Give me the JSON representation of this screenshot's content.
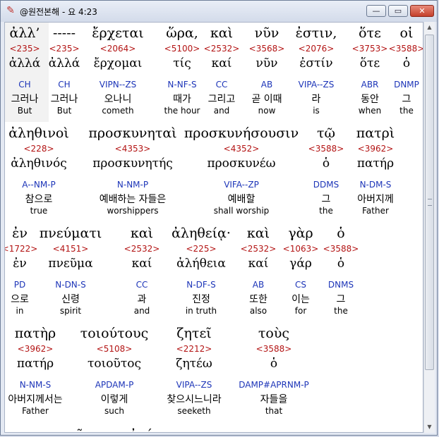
{
  "window": {
    "title": "@원전본해 - 요 4:23",
    "min_label": "—",
    "max_label": "▭",
    "close_label": "✕",
    "app_icon": "pen-icon"
  },
  "verse_rows": [
    {
      "words": [
        {
          "greek": "ἀλλ’",
          "strong": "<235>",
          "lemma": "ἀλλά",
          "parse": "CH",
          "korean": "그러나",
          "english": "But"
        },
        {
          "greek": "-----",
          "strong": "<235>",
          "lemma": "ἀλλά",
          "parse": "CH",
          "korean": "그러나",
          "english": "But"
        },
        {
          "greek": "ἔρχεται",
          "strong": "<2064>",
          "lemma": "ἔρχομαι",
          "parse": "VIPN--ZS",
          "korean": "오나니",
          "english": "cometh"
        },
        {
          "greek": "ὥρα,",
          "strong": "<5100>",
          "lemma": "τίς",
          "parse": "N-NF-S",
          "korean": "때가",
          "english": "the hour"
        },
        {
          "greek": "καὶ",
          "strong": "<2532>",
          "lemma": "καί",
          "parse": "CC",
          "korean": "그리고",
          "english": "and"
        },
        {
          "greek": "νῦν",
          "strong": "<3568>",
          "lemma": "νῦν",
          "parse": "AB",
          "korean": "곧 이때",
          "english": "now"
        },
        {
          "greek": "ἐστιν,",
          "strong": "<2076>",
          "lemma": "ἐστίν",
          "parse": "VIPA--ZS",
          "korean": "라",
          "english": "is"
        },
        {
          "greek": "ὅτε",
          "strong": "<3753>",
          "lemma": "ὅτε",
          "parse": "ABR",
          "korean": "동안",
          "english": "when"
        },
        {
          "greek": "οἱ",
          "strong": "<3588>",
          "lemma": "ὁ",
          "parse": "DNMP",
          "korean": "그",
          "english": "the"
        }
      ]
    },
    {
      "words": [
        {
          "greek": "ἀληθινοὶ",
          "strong": "<228>",
          "lemma": "ἀληθινός",
          "parse": "A--NM-P",
          "korean": "참으로",
          "english": "true"
        },
        {
          "greek": "προσκυνηταὶ",
          "strong": "<4353>",
          "lemma": "προσκυνητής",
          "parse": "N-NM-P",
          "korean": "예배하는 자들은",
          "english": "worshippers"
        },
        {
          "greek": "προσκυνήσουσιν",
          "strong": "<4352>",
          "lemma": "προσκυνέω",
          "parse": "VIFA--ZP",
          "korean": "예배할",
          "english": "shall worship"
        },
        {
          "greek": "τῷ",
          "strong": "<3588>",
          "lemma": "ὁ",
          "parse": "DDMS",
          "korean": "그",
          "english": "the"
        },
        {
          "greek": "πατρὶ",
          "strong": "<3962>",
          "lemma": "πατήρ",
          "parse": "N-DM-S",
          "korean": "아버지께",
          "english": "Father"
        }
      ]
    },
    {
      "words": [
        {
          "greek": "ἐν",
          "strong": "<1722>",
          "lemma": "ἐν",
          "parse": "PD",
          "korean": "으로",
          "english": "in"
        },
        {
          "greek": "πνεύματι",
          "strong": "<4151>",
          "lemma": "πνεῦμα",
          "parse": "N-DN-S",
          "korean": "신령",
          "english": "spirit"
        },
        {
          "greek": "καὶ",
          "strong": "<2532>",
          "lemma": "καί",
          "parse": "CC",
          "korean": "과",
          "english": "and"
        },
        {
          "greek": "ἀληθείᾳ·",
          "strong": "<225>",
          "lemma": "ἀλήθεια",
          "parse": "N-DF-S",
          "korean": "진정",
          "english": "in truth"
        },
        {
          "greek": "καὶ",
          "strong": "<2532>",
          "lemma": "καί",
          "parse": "AB",
          "korean": "또한",
          "english": "also"
        },
        {
          "greek": "γὰρ",
          "strong": "<1063>",
          "lemma": "γάρ",
          "parse": "CS",
          "korean": "이는",
          "english": "for"
        },
        {
          "greek": "ὁ",
          "strong": "<3588>",
          "lemma": "ὁ",
          "parse": "DNMS",
          "korean": "그",
          "english": "the"
        }
      ]
    },
    {
      "words": [
        {
          "greek": "πατὴρ",
          "strong": "<3962>",
          "lemma": "πατήρ",
          "parse": "N-NM-S",
          "korean": "아버지께서는",
          "english": "Father"
        },
        {
          "greek": "τοιούτους",
          "strong": "<5108>",
          "lemma": "τοιοῦτος",
          "parse": "APDAM-P",
          "korean": "이렇게",
          "english": "such"
        },
        {
          "greek": "ζητεῖ",
          "strong": "<2212>",
          "lemma": "ζητέω",
          "parse": "VIPA--ZS",
          "korean": "찾으시느니라",
          "english": "seeketh"
        },
        {
          "greek": "τοὺς",
          "strong": "<3588>",
          "lemma": "ὁ",
          "parse": "DAMP#APRNM-P",
          "korean": "자들을",
          "english": "that"
        }
      ]
    }
  ],
  "next_line": "προσκυνοῦντας αὐτόν",
  "colors": {
    "strong": "#b31414",
    "parse": "#1d35b8",
    "highlight": "#f2f2f2"
  }
}
